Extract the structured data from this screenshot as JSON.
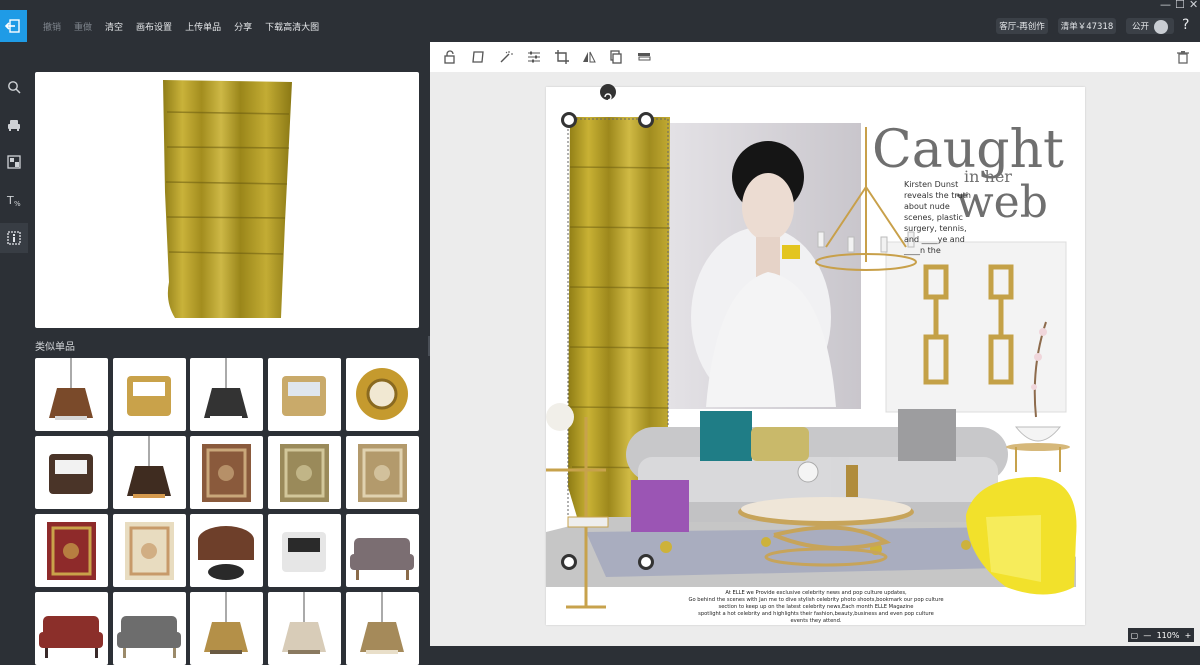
{
  "topbar": {
    "undo": "撤销",
    "redo": "重做",
    "clear": "清空",
    "canvas_settings": "画布设置",
    "upload_item": "上传单品",
    "share": "分享",
    "download_hd": "下载高清大图",
    "scene_label": "客厅-再创作",
    "list_label": "清单￥47318",
    "public_label": "公开",
    "help_label": "?"
  },
  "window": {
    "minimize": "—",
    "maximize": "☐",
    "close": "✕"
  },
  "left_nav": {
    "icons": [
      "search-icon",
      "armchair-icon",
      "gallery-icon",
      "text-icon",
      "info-icon"
    ]
  },
  "panel": {
    "similar_title": "类似单品",
    "thumbnails": [
      "plane-chandelier",
      "gold-leaf-wall-decor",
      "linear-pendant-light",
      "crystal-bowl-side-tables",
      "sunburst-mirror",
      "display-side-table",
      "lantern-post-light",
      "brown-rug",
      "olive-rug",
      "beige-rug",
      "patchwork-rug",
      "ivory-medallion-rug",
      "leather-ottoman",
      "drum-stools",
      "lounge-chair",
      "red-armchair",
      "grey-sofa",
      "rectangular-chandelier",
      "drum-pendant",
      "geometric-pendant"
    ]
  },
  "canvas": {
    "toolbar_icons": [
      "lock-icon",
      "crop-frame-icon",
      "magic-wand-icon",
      "adjust-icon",
      "crop-icon",
      "flip-icon",
      "layer-copy-icon",
      "layer-stack-icon",
      "trash-icon"
    ],
    "board": {
      "headline1": "Caught",
      "headline2": "in her",
      "headline3": "web",
      "body_text": [
        "Kirsten Dunst",
        "reveals the truth",
        "about nude",
        "scenes, plastic",
        "surgery, tennis,",
        "and ____ye and",
        "____n the"
      ],
      "caption": [
        "At ELLE we Provide exclusive celebrity news and pop culture updates,",
        "Go behind the scenes with Jan me to dive stylish celebrity photo shoots,bookmark our pop culture",
        "section to keep up on the latest celebrity news,Each month ELLE Magazine",
        "spotlight  a hot celebrity and highlights their fashion,beauty,business and even pop culture",
        "events they attend."
      ]
    },
    "zoom": {
      "zoom_out": "—",
      "zoom_level": "110%",
      "zoom_in": "+"
    }
  },
  "colors": {
    "accent_blue": "#1f9be6",
    "dark_ui": "#2c3036",
    "curtain_yellow": "#b9a326"
  }
}
